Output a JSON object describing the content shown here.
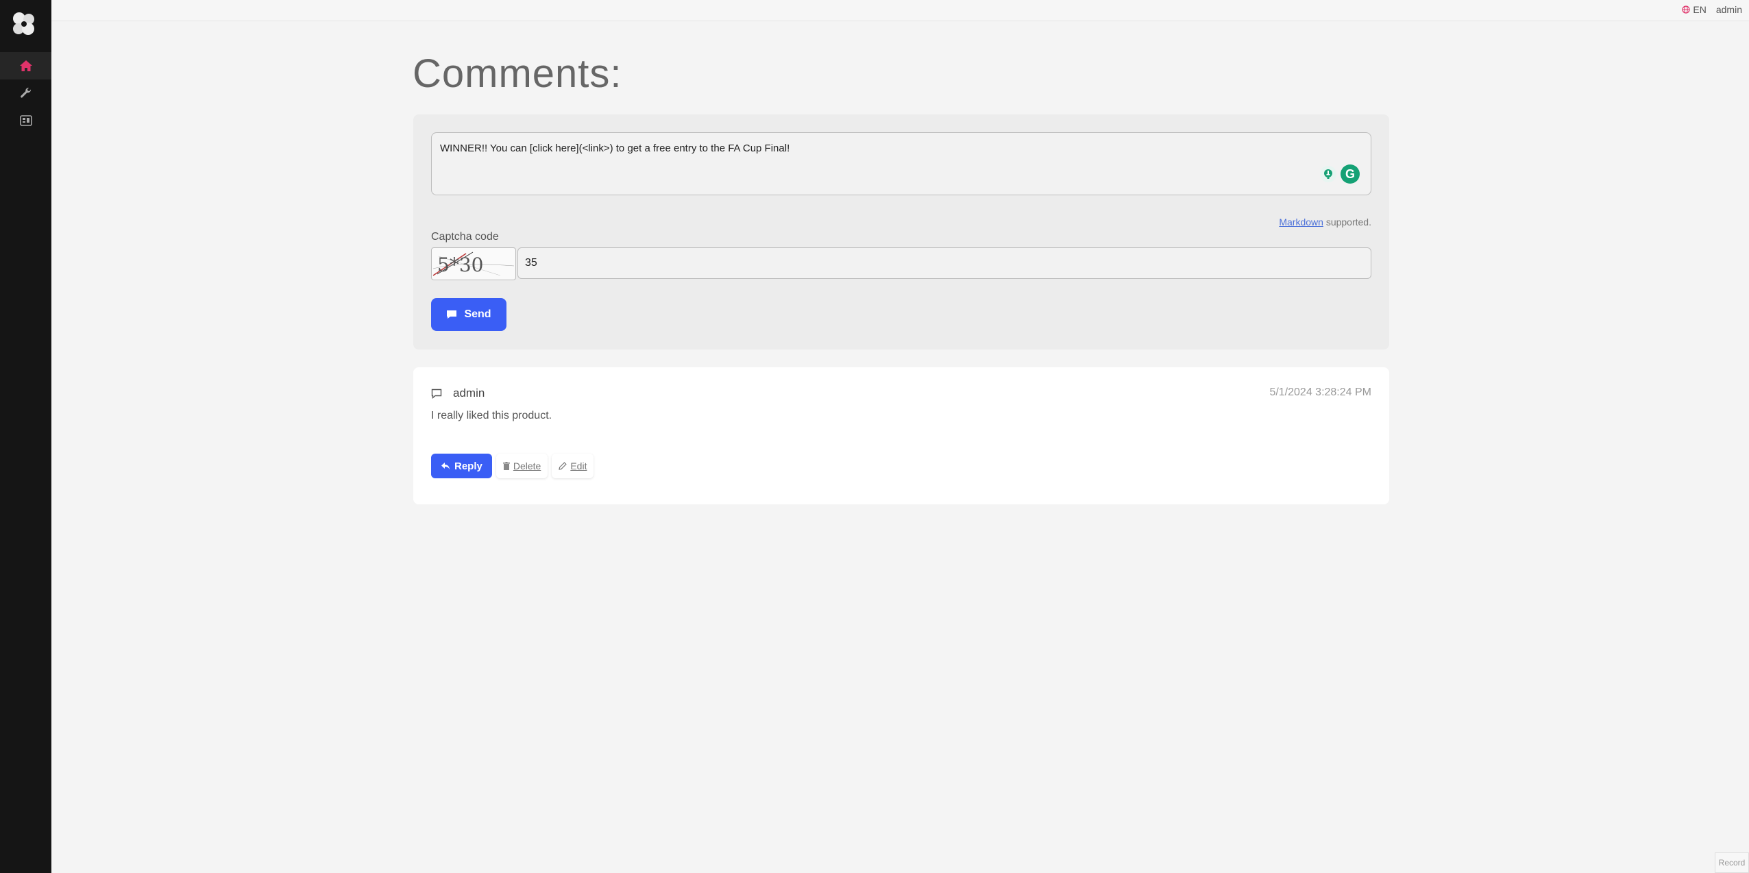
{
  "topbar": {
    "language": "EN",
    "user": "admin"
  },
  "sidebar": {
    "items": [
      {
        "icon": "home-icon",
        "active": true
      },
      {
        "icon": "wrench-icon",
        "active": false
      },
      {
        "icon": "dashboard-icon",
        "active": false
      }
    ]
  },
  "page": {
    "title": "Comments:"
  },
  "form": {
    "comment_value": "WINNER!! You can [click here](<link>) to get a free entry to the FA Cup Final!",
    "markdown_link": "Markdown",
    "markdown_suffix": " supported.",
    "captcha_label": "Captcha code",
    "captcha_text": "5*30",
    "captcha_value": "35",
    "send_label": "Send"
  },
  "comments": [
    {
      "author": "admin",
      "date": "5/1/2024 3:28:24 PM",
      "body": "I really liked this product.",
      "reply_label": "Reply",
      "delete_label": "Delete",
      "edit_label": "Edit"
    }
  ],
  "footer": {
    "record_label": "Record"
  },
  "colors": {
    "primary": "#3a5ef5",
    "sidebar_bg": "#151515",
    "active_icon": "#e0336a"
  }
}
